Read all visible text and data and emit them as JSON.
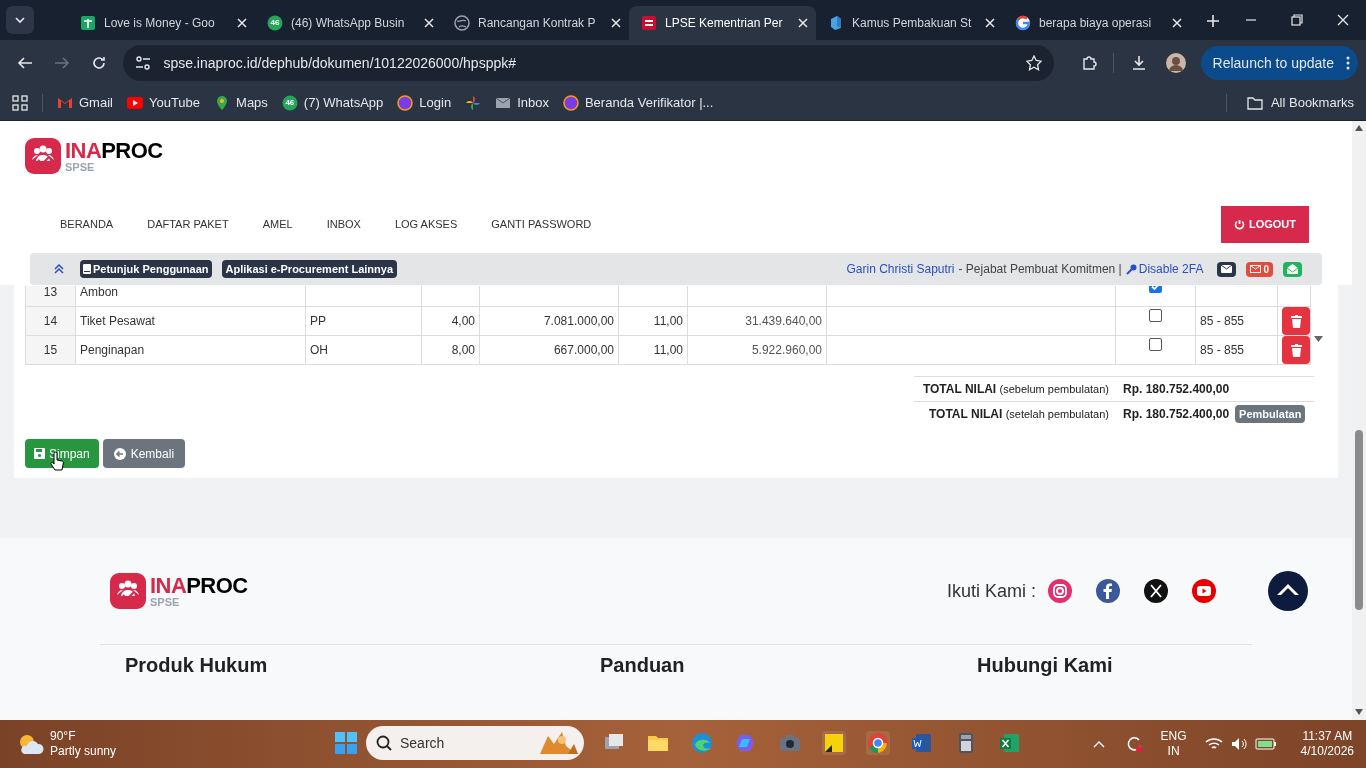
{
  "browser": {
    "tabs": [
      {
        "title": "Love is Money - Goo",
        "selected": false
      },
      {
        "title": "(46) WhatsApp Busin",
        "selected": false,
        "badge": "46"
      },
      {
        "title": "Rancangan Kontrak P",
        "selected": false
      },
      {
        "title": "LPSE Kementrian Per",
        "selected": true
      },
      {
        "title": "Kamus Pembakuan St",
        "selected": false
      },
      {
        "title": "berapa biaya operasi",
        "selected": false
      }
    ],
    "address": "spse.inaproc.id/dephub/dokumen/10122026000/hpsppk#",
    "relaunch": "Relaunch to update",
    "bookmarks": [
      {
        "kind": "link",
        "label": "Gmail"
      },
      {
        "kind": "link",
        "label": "YouTube"
      },
      {
        "kind": "link",
        "label": "Maps"
      },
      {
        "kind": "link",
        "label": "(7) WhatsApp",
        "badge": "46"
      },
      {
        "kind": "link",
        "label": "Login"
      },
      {
        "kind": "icon"
      },
      {
        "kind": "link",
        "label": "Inbox"
      },
      {
        "kind": "link",
        "label": "Beranda Verifikator |..."
      }
    ],
    "all_bookmarks": "All Bookmarks"
  },
  "page": {
    "logo": {
      "brand_a": "INA",
      "brand_b": "PROC",
      "sub": "SPSE"
    },
    "nav": [
      "BERANDA",
      "DAFTAR PAKET",
      "AMEL",
      "INBOX",
      "LOG AKSES",
      "GANTI PASSWORD"
    ],
    "logout": "LOGOUT",
    "info_bar": {
      "guide": "Petunjuk Penggunaan",
      "apps": "Aplikasi e-Procurement Lainnya",
      "user": "Garin Christi Saputri",
      "role": "- Pejabat Pembuat Komitmen |",
      "disable_2fa": "Disable 2FA",
      "unread": "0"
    },
    "table": {
      "rows": [
        {
          "no": "13",
          "item": "Ambon",
          "unit": "",
          "qty": "",
          "price": "",
          "factor": "",
          "total": "",
          "checked": true,
          "range": ""
        },
        {
          "no": "14",
          "item": "Tiket Pesawat",
          "unit": "PP",
          "qty": "4,00",
          "price": "7.081.000,00",
          "factor": "11,00",
          "total": "31.439.640,00",
          "checked": false,
          "range": "85 - 855"
        },
        {
          "no": "15",
          "item": "Penginapan",
          "unit": "OH",
          "qty": "8,00",
          "price": "667.000,00",
          "factor": "11,00",
          "total": "5.922.960,00",
          "checked": false,
          "range": "85 - 855"
        }
      ]
    },
    "totals": [
      {
        "label": "TOTAL NILAI",
        "note": "(sebelum pembulatan)",
        "value": "Rp. 180.752.400,00"
      },
      {
        "label": "TOTAL NILAI",
        "note": "(setelah pembulatan)",
        "value": "Rp. 180.752.400,00",
        "badge": "Pembulatan"
      }
    ],
    "buttons": {
      "save": "Simpan",
      "back": "Kembali"
    },
    "footer": {
      "logo": {
        "brand_a": "INA",
        "brand_b": "PROC",
        "sub": "SPSE"
      },
      "follow": "Ikuti Kami :",
      "headings": [
        "Produk Hukum",
        "Panduan",
        "Hubungi Kami"
      ]
    }
  },
  "taskbar": {
    "temperature": "90°F",
    "weather": "Partly sunny",
    "search": "Search",
    "lang": "ENG",
    "region": "IN",
    "time": "11:37 AM",
    "date": "4/10/2026"
  }
}
